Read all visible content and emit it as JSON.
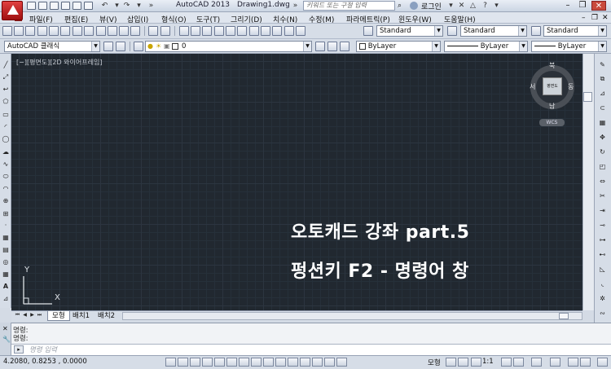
{
  "titlebar": {
    "app_title": "AutoCAD 2013",
    "doc_title": "Drawing1.dwg",
    "search_placeholder": "키워드 또는 구절 입력",
    "login_label": "로그인"
  },
  "menubar": {
    "items": [
      "파일(F)",
      "편집(E)",
      "뷰(V)",
      "삽입(I)",
      "형식(O)",
      "도구(T)",
      "그리기(D)",
      "치수(N)",
      "수정(M)",
      "파라메트릭(P)",
      "윈도우(W)",
      "도움말(H)"
    ]
  },
  "toolbar1": {
    "text_style": "Standard",
    "dim_style": "Standard",
    "table_style": "Standard"
  },
  "toolbar2": {
    "workspace": "AutoCAD 클래식",
    "layer": "0",
    "color": "ByLayer",
    "linetype": "ByLayer",
    "lineweight": "ByLayer"
  },
  "viewport": {
    "label": "[−][평면도][2D 와이어프레임]",
    "overlay_line1": "오토캐드 강좌 part.5",
    "overlay_line2": "펑션키 F2 - 명령어 창",
    "ucs_x": "X",
    "ucs_y": "Y",
    "viewcube": {
      "north": "북",
      "south": "남",
      "east": "동",
      "west": "서",
      "face": "평면도",
      "wcs": "WCS"
    }
  },
  "layout_tabs": [
    "모형",
    "배치1",
    "배치2"
  ],
  "command": {
    "history": [
      "명령:",
      "명령:"
    ],
    "placeholder": "명령 입력"
  },
  "statusbar": {
    "coordinates": "4.2080, 0.8253 , 0.0000",
    "model_label": "모형",
    "scale_label": "1:1"
  }
}
